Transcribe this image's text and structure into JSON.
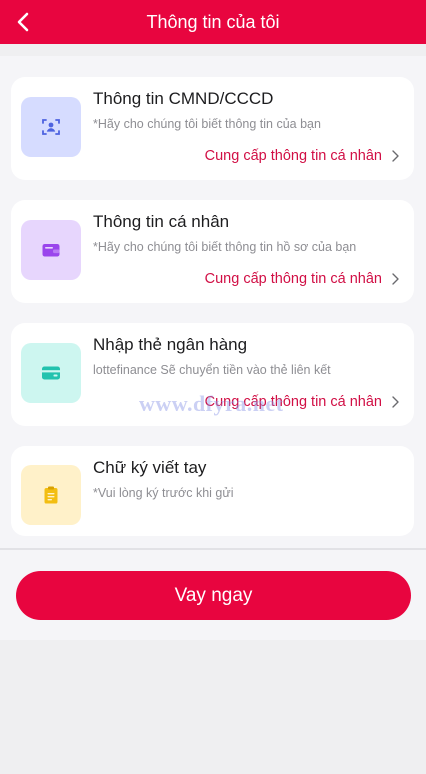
{
  "header": {
    "title": "Thông tin của tôi",
    "back_icon": "chevron-left-icon"
  },
  "cards": [
    {
      "title": "Thông tin CMND/CCCD",
      "desc": "*Hãy cho chúng tôi biết thông tin của bạn",
      "link": "Cung cấp thông tin cá nhân",
      "icon": "id-scan-icon",
      "icon_bg": "#d6dcff",
      "icon_color": "#4e63e0"
    },
    {
      "title": "Thông tin cá nhân",
      "desc": "*Hãy cho chúng tôi biết thông tin hồ sơ của bạn",
      "link": "Cung cấp thông tin cá nhân",
      "icon": "wallet-icon",
      "icon_bg": "#e7d6fd",
      "icon_color": "#9a45ec"
    },
    {
      "title": "Nhập thẻ ngân hàng",
      "desc": "lottefinance Sẽ chuyển tiền vào thẻ liên kết",
      "link": "Cung cấp thông tin cá nhân",
      "icon": "bank-card-icon",
      "icon_bg": "#cdf6f0",
      "icon_color": "#22c2ae"
    },
    {
      "title": "Chữ ký viết tay",
      "desc": "*Vui lòng ký trước khi gửi",
      "icon": "clipboard-icon",
      "icon_bg": "#fff1c9",
      "icon_color": "#f3be12"
    }
  ],
  "watermark": "www.dfyra.net",
  "cta": {
    "label": "Vay ngay"
  },
  "colors": {
    "accent": "#e8053f",
    "link": "#d10f45"
  }
}
